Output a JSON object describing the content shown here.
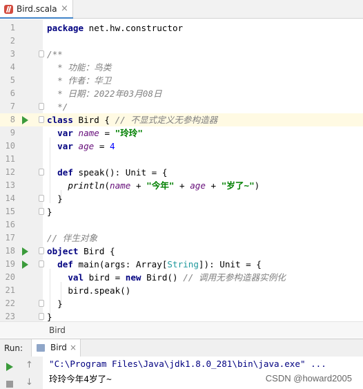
{
  "tab": {
    "filename": "Bird.scala",
    "close": "×"
  },
  "breadcrumb": "Bird",
  "run": {
    "label": "Run:",
    "tab": "Bird",
    "close": "×",
    "output": [
      "\"C:\\Program Files\\Java\\jdk1.8.0_281\\bin\\java.exe\" ...",
      "玲玲今年4岁了~"
    ]
  },
  "watermark": "CSDN @howard2005",
  "code": {
    "line_numbers": [
      "1",
      "2",
      "3",
      "4",
      "5",
      "6",
      "7",
      "8",
      "9",
      "10",
      "11",
      "12",
      "13",
      "14",
      "15",
      "16",
      "17",
      "18",
      "19",
      "20",
      "21",
      "22",
      "23"
    ],
    "l1": {
      "kw": "package",
      "rest": " net.hw.constructor"
    },
    "l3": "/**",
    "l4": "  * 功能：鸟类",
    "l5": "  * 作者：华卫",
    "l6": "  * 日期：2022年03月08日",
    "l7": "  */",
    "l8": {
      "kw": "class",
      "name": " Bird { ",
      "comment": "// 不显式定义无参构造器"
    },
    "l9": {
      "kw": "var",
      "var": "name",
      "eq": " = ",
      "str": "\"玲玲\""
    },
    "l10": {
      "kw": "var",
      "var": "age",
      "eq": " = ",
      "num": "4"
    },
    "l12": {
      "kw": "def",
      "rest": " speak(): Unit = {"
    },
    "l13": {
      "fn": "println",
      "p1": "(",
      "v1": "name",
      "p2": " + ",
      "s1": "\"今年\"",
      "p3": " + ",
      "v2": "age",
      "p4": " + ",
      "s2": "\"岁了~\"",
      "p5": ")"
    },
    "l14": "}",
    "l15": "}",
    "l17": "// 伴生对象",
    "l18": {
      "kw": "object",
      "rest": " Bird {"
    },
    "l19": {
      "kw": "def",
      "rest1": " main(args: Array[",
      "type": "String",
      "rest2": "]): Unit = {"
    },
    "l20": {
      "kw1": "val",
      "rest1": " bird = ",
      "kw2": "new",
      "rest2": " Bird() ",
      "comment": "// 调用无参构造器实例化"
    },
    "l21": "bird.speak()",
    "l22": "}",
    "l23": "}"
  }
}
